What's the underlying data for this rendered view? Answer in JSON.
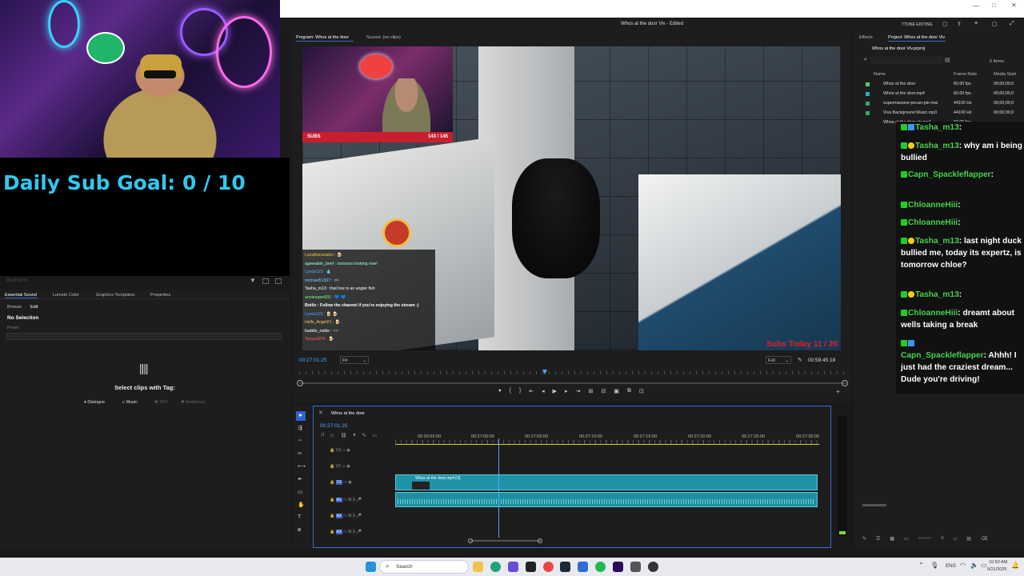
{
  "overlay": {
    "sub_goal": "Daily Sub Goal:  0 / 10",
    "left_timestamp": "00:27:01:25"
  },
  "window": {
    "title": "Whos at the door Viv - Edited",
    "workspace": "TTONE EDITING"
  },
  "program_monitor": {
    "tab_program": "Program: Whos at the door",
    "tab_source": "Source: (no clips)",
    "timecode": "00:27:01:25",
    "fit": "Fit",
    "quality": "Full",
    "duration": "00:59:45:18",
    "subs_label": "SUBS",
    "subs_count": "143 / 145",
    "subs_today": "Subs Today  11 / 20",
    "inner_chat": [
      "LanaBananakin : 🍺",
      "agreeable_beef : ooooooo looking now!",
      "Lynda123 : 💧",
      "michael51997 : 🎮",
      "Tasha_m13 : that hoe is an angler fish",
      "annieegee831 : 💙 💙",
      "Botlix : Follow the channel if you're enjoying the stream :)",
      "Lynda123 : 🍺 🍺",
      "Hells_Angel21 : 🍺",
      "baddie_nattie : 👓",
      "Tanya1976 : 🍺"
    ]
  },
  "left_panels": {
    "tabs": [
      "Essential Sound",
      "Lumetri Color",
      "Graphics Templates",
      "Properties"
    ],
    "subtabs": [
      "Browse",
      "Edit"
    ],
    "selection": "No Selection",
    "preset_label": "Preset",
    "select_clips": "Select clips with Tag:",
    "tags": [
      "Dialogue",
      "Music",
      "SFX",
      "Ambience"
    ]
  },
  "project": {
    "tab_effects": "Effects",
    "tab_project": "Project: Whos at the door Viv",
    "file": "Whos at the door Viv.prproj",
    "items_count": "5 Items",
    "col_name": "Name",
    "col_rate": "Frame Rate",
    "col_start": "Media Start",
    "rows": [
      {
        "name": "Whos at the door",
        "rate": "60.00 fps",
        "start": "00;00;00;0"
      },
      {
        "name": "Whos at the door.mp4",
        "rate": "60.00 fps",
        "start": "00;00;00;0"
      },
      {
        "name": "supermassive-pecan-pie-mai",
        "rate": "44100 Hz",
        "start": "00;00;00;0"
      },
      {
        "name": "Viva Background Music.mp3",
        "rate": "44100 Hz",
        "start": "00;00;00;0"
      },
      {
        "name": "Whos at the door viv.mp4",
        "rate": "60.00 fps",
        "start": "00;00;00;0"
      }
    ]
  },
  "chat": [
    {
      "name": "Tasha_m13",
      "text": ""
    },
    {
      "name": "Tasha_m13",
      "text": "why am i being bullied"
    },
    {
      "name": "Capn_Spackleflapper",
      "text": ""
    },
    {
      "name": "ChloanneHiii",
      "text": ""
    },
    {
      "name": "ChloanneHiii",
      "text": ""
    },
    {
      "name": "Tasha_m13",
      "text": "last night duck bullied me, today its expertz, is tomorrow chloe?"
    },
    {
      "name": "Tasha_m13",
      "text": ""
    },
    {
      "name": "ChloanneHiii",
      "text": "dreamt about wells taking a break"
    },
    {
      "name": "Capn_Spackleflapper",
      "text": "Ahhh! I just had the craziest dream... Dude you're driving!"
    }
  ],
  "timeline": {
    "sequence": "Whos at the door",
    "timecode": "00:27:01:25",
    "ruler": [
      "00:26:55:00",
      "00:27:00:00",
      "00:27:05:00",
      "00:27:10:00",
      "00:27:15:00",
      "00:27:20:00",
      "00:27:25:00",
      "00:27:30:00"
    ],
    "tracks_video": [
      "V3",
      "V2",
      "V1"
    ],
    "tracks_audio": [
      "A1",
      "A2",
      "A3"
    ],
    "clip_label": "Whos at the door.mp4 [V]",
    "playhead_fraction": 0.245
  },
  "taskbar": {
    "search": "Search",
    "lang": "ENG",
    "time": "10:50 AM",
    "date": "9/21/2025"
  }
}
